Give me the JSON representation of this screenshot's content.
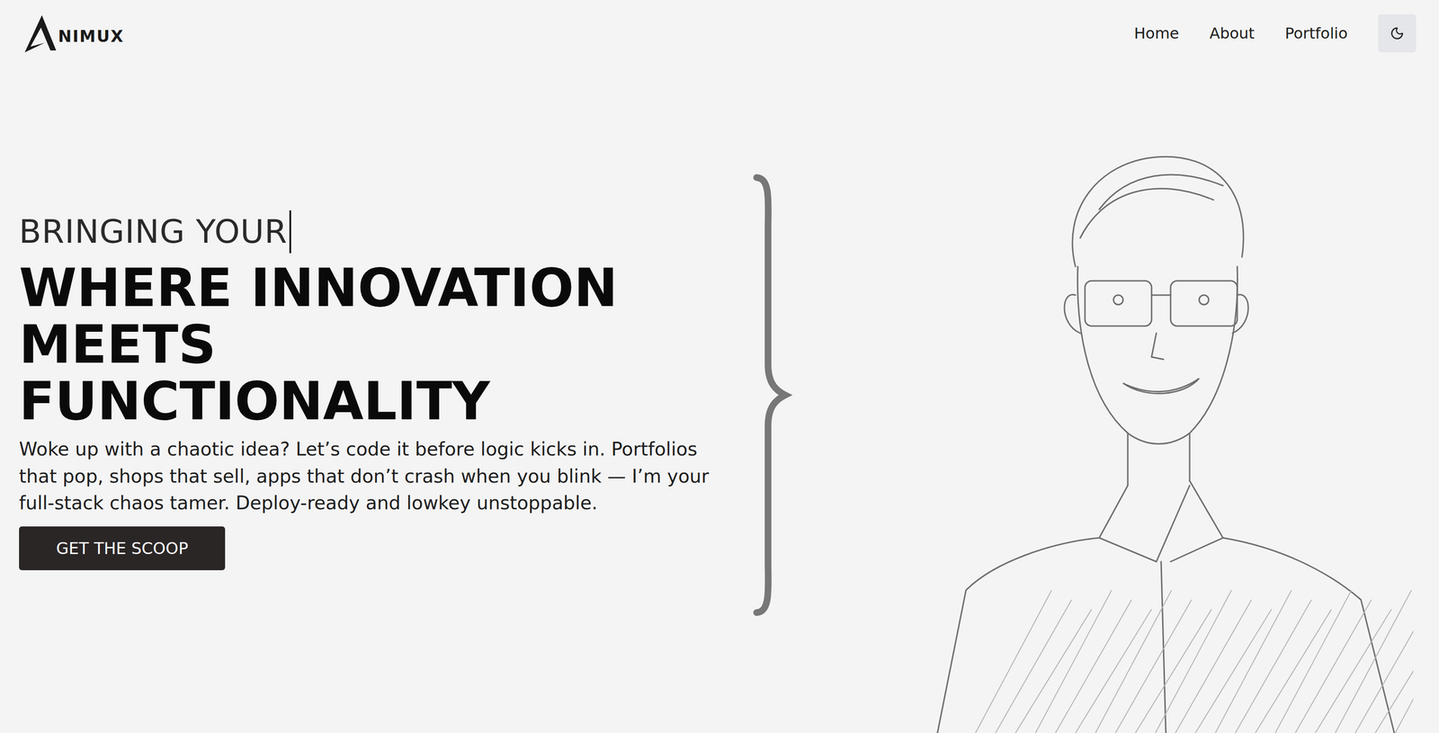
{
  "nav": {
    "logo": "NIMUX",
    "links": [
      {
        "label": "Home"
      },
      {
        "label": "About"
      },
      {
        "label": "Portfolio"
      }
    ],
    "theme_toggle": {
      "dark": false
    }
  },
  "hero": {
    "typing": "BRINGING YOUR",
    "headline": [
      "WHERE INNOVATION",
      "MEETS",
      "FUNCTIONALITY"
    ],
    "description": "Woke up with a chaotic idea? Let’s code it before logic kicks in. Portfolios that pop, shops that sell, apps that don’t crash when you blink — I’m your full-stack chaos tamer. Deploy-ready and lowkey unstoppable.",
    "button": "GET THE SCOOP"
  }
}
